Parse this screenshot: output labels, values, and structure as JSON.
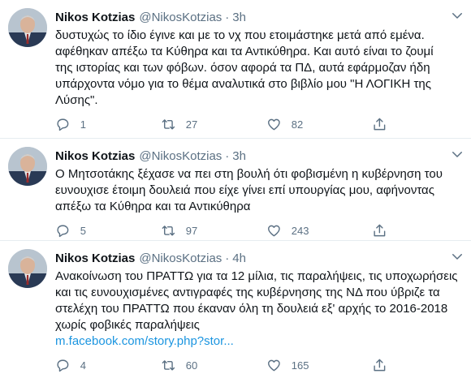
{
  "tweets": [
    {
      "name": "Nikos Kotzias",
      "handle": "@NikosKotzias",
      "separator": "·",
      "time": "3h",
      "text": "δυστυχώς το ίδιο έγινε και με το νχ που ετοιμάστηκε μετά από εμένα.\nαφέθηκαν απέξω τα Κύθηρα και τα Αντικύθηρα. Και αυτό είναι το ζουμί\nτης ιστορίας και των φόβων. όσον αφορά τα ΠΔ, αυτά εφάρμοζαν ήδη\nυπάρχοντα νόμο για το θέμα αναλυτικά στο βιβλίο μου \"Η ΛΟΓΙΚΗ της\nΛύσης\".",
      "link": "",
      "replies": "1",
      "retweets": "27",
      "likes": "82"
    },
    {
      "name": "Nikos Kotzias",
      "handle": "@NikosKotzias",
      "separator": "·",
      "time": "3h",
      "text": "Ο Μητσοτάκης ξέχασε να πει στη βουλή ότι φοβισμένη η κυβέρνηση του\nευνουχισε έτοιμη δουλειά που είχε γίνει επί υπουργίας μου, αφήνοντας\nαπέξω τα Κύθηρα και τα Αντικύθηρα",
      "link": "",
      "replies": "5",
      "retweets": "97",
      "likes": "243"
    },
    {
      "name": "Nikos Kotzias",
      "handle": "@NikosKotzias",
      "separator": "·",
      "time": "4h",
      "text": "Ανακοίνωση του ΠΡΑΤΤΩ για τα 12 μίλια, τις παραλήψεις, τις υποχωρήσεις\nκαι τις ευνουχισμένες αντιγραφές της κυβέρνησης της ΝΔ που ύβριζε τα\nστελέχη του ΠΡΑΤΤΩ που έκαναν όλη τη δουλειά εξ' αρχής το 2016-2018\nχωρίς φοβικές παραλήψεις",
      "link": "m.facebook.com/story.php?stor...",
      "replies": "4",
      "retweets": "60",
      "likes": "165"
    }
  ],
  "icons": {
    "reply": "reply-icon",
    "retweet": "retweet-icon",
    "like": "like-icon",
    "share": "share-icon",
    "caret": "chevron-down-icon"
  },
  "colors": {
    "text": "#0f1419",
    "muted": "#5b7083",
    "link": "#1b95e0",
    "divider": "#e6ecf0"
  }
}
